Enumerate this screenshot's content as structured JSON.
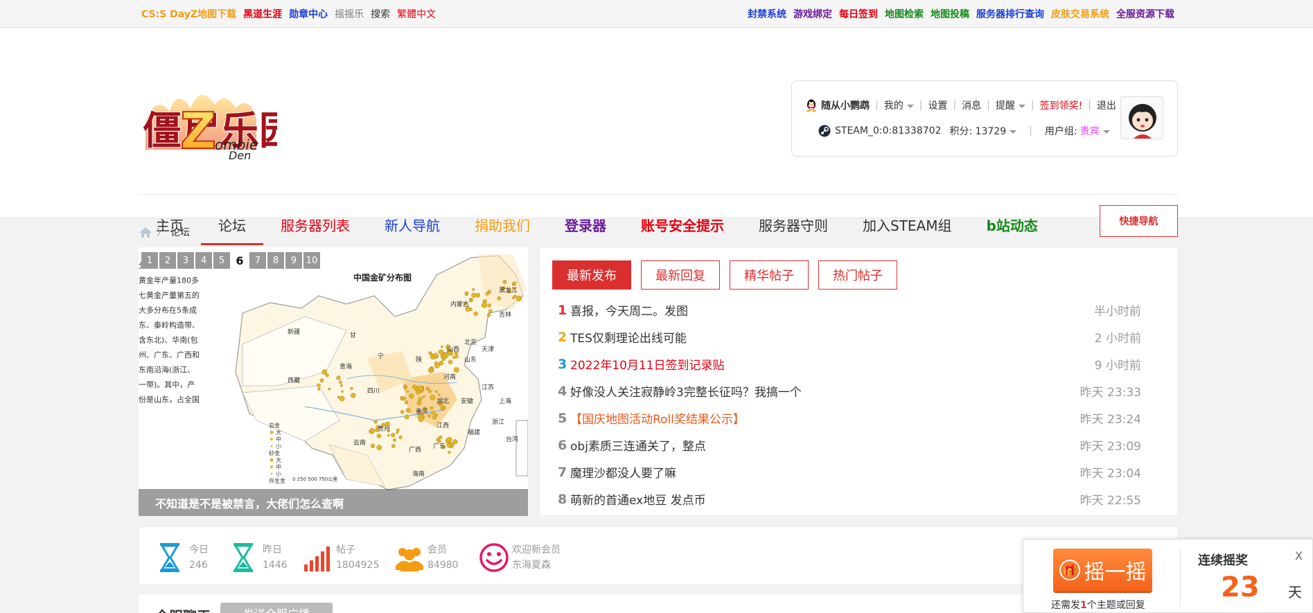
{
  "topbar": {
    "left_links": [
      {
        "label": "CS:S DayZ地图下载",
        "color": "#f39c12",
        "bold": true
      },
      {
        "label": "黑道生涯",
        "color": "#e60012",
        "bold": true
      },
      {
        "label": "勋章中心",
        "color": "#1a3fd6",
        "bold": true
      },
      {
        "label": "摇摇乐",
        "color": "#777777",
        "bold": false
      },
      {
        "label": "搜索",
        "color": "#333333",
        "bold": false
      },
      {
        "label": "繁體中文",
        "color": "#e60012",
        "bold": false
      }
    ],
    "right_links": [
      {
        "label": "封禁系统",
        "color": "#1a3fd6"
      },
      {
        "label": "游戏绑定",
        "color": "#6a1b9a"
      },
      {
        "label": "每日签到",
        "color": "#e60012"
      },
      {
        "label": "地图检索",
        "color": "#168a1b"
      },
      {
        "label": "地图投稿",
        "color": "#168a1b"
      },
      {
        "label": "服务器排行查询",
        "color": "#1a3fd6"
      },
      {
        "label": "皮肤交易系统",
        "color": "#f39c12"
      },
      {
        "label": "全服资源下载",
        "color": "#6a1b9a"
      }
    ]
  },
  "logo": {
    "main": "僵尸乐园",
    "sub1": "ombie",
    "sub2": "Den",
    "z": "Z"
  },
  "user": {
    "name": "随从小鹦鹉",
    "my": "我的",
    "settings": "设置",
    "messages": "消息",
    "remind": "提醒",
    "signin": "签到领奖!",
    "logout": "退出",
    "steam": "STEAM_0:0:81338702",
    "points": "积分: 13729",
    "group_label": "用户组:",
    "group": "贵宾"
  },
  "nav": [
    {
      "label": "主页",
      "color": "#333333",
      "bold": false,
      "active": false
    },
    {
      "label": "论坛",
      "color": "#333333",
      "bold": false,
      "active": true
    },
    {
      "label": "服务器列表",
      "color": "#e60012",
      "bold": false,
      "active": false
    },
    {
      "label": "新人导航",
      "color": "#1a3fd6",
      "bold": false,
      "active": false
    },
    {
      "label": "捐助我们",
      "color": "#f39c12",
      "bold": false,
      "active": false
    },
    {
      "label": "登录器",
      "color": "#6a1b9a",
      "bold": true,
      "active": false
    },
    {
      "label": "账号安全提示",
      "color": "#e60012",
      "bold": true,
      "active": false
    },
    {
      "label": "服务器守则",
      "color": "#333333",
      "bold": false,
      "active": false
    },
    {
      "label": "加入STEAM组",
      "color": "#333333",
      "bold": false,
      "active": false
    },
    {
      "label": "b站动态",
      "color": "#168a1b",
      "bold": true,
      "active": false
    }
  ],
  "quicknav": "快捷导航",
  "breadcrumb": {
    "sep": "〉",
    "current": "论坛"
  },
  "slider": {
    "dots": [
      "1",
      "2",
      "3",
      "4",
      "5",
      "6",
      "7",
      "8",
      "9",
      "10"
    ],
    "active_dot": 5,
    "caption": "不知道是不是被禁言，大佬们怎么查啊",
    "map_title": "中国金矿分布图",
    "side_text": [
      "分布",
      "黄金年产量180多",
      "七黄金产量第五的",
      "大多分布在5条成",
      "东、秦岭构造带、",
      "含东北)、华南(包",
      "州、广东、广西和",
      "东南沿海(浙江、",
      "一带)。其中，产",
      "份是山东，占全国"
    ],
    "provinces": [
      "新疆",
      "西藏",
      "青海",
      "甘",
      "内蒙古",
      "黑龙江",
      "吉林",
      "北京",
      "天津",
      "山西",
      "陕",
      "山东",
      "河南",
      "江苏",
      "四川",
      "湖北",
      "安徽",
      "上海",
      "重庆",
      "浙江",
      "贵州",
      "江西",
      "福建",
      "云南",
      "广西",
      "广东",
      "海南",
      "宁",
      "台湾"
    ],
    "legend": [
      "岩金",
      "大",
      "中",
      "小",
      "砂金",
      "大",
      "中",
      "小",
      "伴生金"
    ],
    "scale": "0   250   500   750公里"
  },
  "tabs": [
    "最新发布",
    "最新回复",
    "精华帖子",
    "热门帖子"
  ],
  "posts": [
    {
      "num": "1",
      "title": "喜报，今天周二。发图",
      "time": "半小时前",
      "color": "#333333"
    },
    {
      "num": "2",
      "title": "TES仅剩理论出线可能",
      "time": "2 小时前",
      "color": "#333333"
    },
    {
      "num": "3",
      "title": "2022年10月11日签到记录贴",
      "time": "9 小时前",
      "color": "#e60012"
    },
    {
      "num": "4",
      "title": "好像没人关注寂静岭3完整长征吗？我搞一个",
      "time": "昨天 23:33",
      "color": "#333333"
    },
    {
      "num": "5",
      "title": "【国庆地图活动Roll奖结果公示】",
      "time": "昨天 23:24",
      "color": "#e85a1a"
    },
    {
      "num": "6",
      "title": "obj素质三连通关了，整点",
      "time": "昨天 23:09",
      "color": "#333333"
    },
    {
      "num": "7",
      "title": "魔理沙都没人要了嘛",
      "time": "昨天 23:04",
      "color": "#333333"
    },
    {
      "num": "8",
      "title": "萌新的首通ex地豆 发点币",
      "time": "昨天 22:55",
      "color": "#333333"
    }
  ],
  "stats": [
    {
      "label": "今日",
      "value": "246",
      "icon": "hourglass-icon",
      "color": "#1a9ad6"
    },
    {
      "label": "昨日",
      "value": "1446",
      "icon": "hourglass-icon",
      "color": "#1abc9c"
    },
    {
      "label": "帖子",
      "value": "1804925",
      "icon": "signal-bars-icon",
      "color": "#e8452c"
    },
    {
      "label": "会员",
      "value": "84980",
      "icon": "users-icon",
      "color": "#f39c12"
    },
    {
      "label": "欢迎新会员",
      "value": "东海夏森",
      "icon": "smiley-icon",
      "color": "#e6156b"
    }
  ],
  "chat": {
    "title": "全服聊天",
    "button": "发送全服广播"
  },
  "popup": {
    "button": "摇一摇",
    "streak_title": "连续摇奖",
    "streak_days": "23",
    "unit": "天",
    "close": "X",
    "hint_pre": "还需发",
    "hint_count": "1",
    "hint_post": "个主题或回复"
  }
}
